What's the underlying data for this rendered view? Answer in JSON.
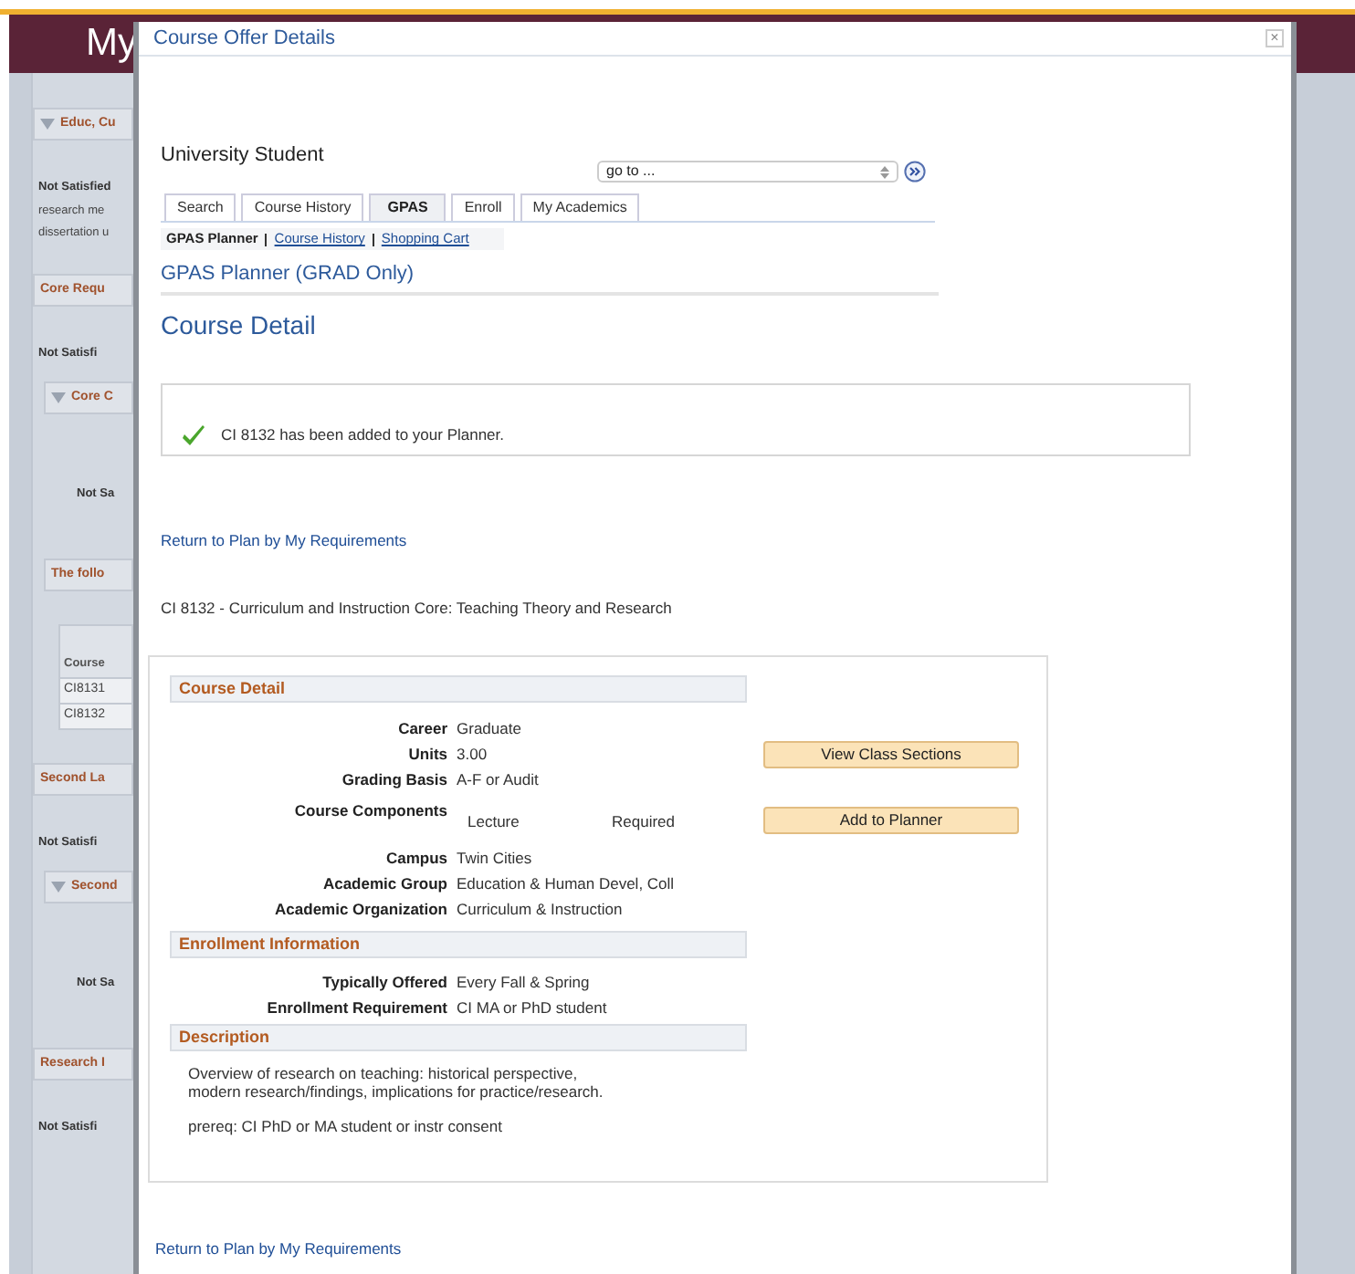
{
  "background": {
    "header_title": "My",
    "items": [
      {
        "kind": "section",
        "text": "Educ, Cu",
        "collapsible": true
      },
      {
        "kind": "status",
        "text": "Not Satisfied"
      },
      {
        "kind": "note",
        "text": "research me"
      },
      {
        "kind": "note",
        "text": "dissertation u"
      },
      {
        "kind": "section",
        "text": "Core Requ",
        "collapsible": false
      },
      {
        "kind": "status",
        "text": "Not Satisfi"
      },
      {
        "kind": "subsection",
        "text": "Core C",
        "collapsible": true
      },
      {
        "kind": "substatus",
        "text": "Not Sa"
      },
      {
        "kind": "subsection",
        "text": "The follo",
        "collapsible": false
      },
      {
        "kind": "table",
        "header": "Course",
        "rows": [
          "CI8131",
          "CI8132"
        ]
      },
      {
        "kind": "section",
        "text": "Second La",
        "collapsible": false
      },
      {
        "kind": "status",
        "text": "Not Satisfi"
      },
      {
        "kind": "subsection",
        "text": "Second",
        "collapsible": true
      },
      {
        "kind": "substatus",
        "text": "Not Sa"
      },
      {
        "kind": "section",
        "text": "Research I",
        "collapsible": false
      },
      {
        "kind": "status",
        "text": "Not Satisfi"
      }
    ]
  },
  "modal": {
    "title": "Course Offer Details",
    "close": "×",
    "student": "University Student",
    "goto": {
      "value": "go to ..."
    },
    "tabs": [
      {
        "label": "Search",
        "selected": false
      },
      {
        "label": "Course History",
        "selected": false
      },
      {
        "label": "GPAS",
        "selected": true
      },
      {
        "label": "Enroll",
        "selected": false
      },
      {
        "label": "My Academics",
        "selected": false
      }
    ],
    "sublinks": [
      {
        "label": "GPAS Planner",
        "selected": true
      },
      {
        "label": "Course History",
        "selected": false
      },
      {
        "label": "Shopping Cart",
        "selected": false
      }
    ],
    "page_title": "GPAS Planner (GRAD Only)",
    "heading": "Course Detail",
    "message": "CI 8132 has been added to your Planner.",
    "return_link": "Return to Plan by My Requirements",
    "course_title": "CI 8132 - Curriculum and Instruction Core: Teaching Theory and Research",
    "sections": [
      {
        "title": "Course Detail",
        "fields": [
          {
            "kind": "pair",
            "label": "Career",
            "value": "Graduate"
          },
          {
            "kind": "pair",
            "label": "Units",
            "value": "3.00"
          },
          {
            "kind": "pair",
            "label": "Grading Basis",
            "value": "A-F or Audit"
          },
          {
            "kind": "components",
            "label": "Course Components",
            "values": [
              "Lecture",
              "Required"
            ]
          },
          {
            "kind": "pair",
            "label": "Campus",
            "value": "Twin Cities"
          },
          {
            "kind": "pair",
            "label": "Academic Group",
            "value": "Education & Human Devel, Coll"
          },
          {
            "kind": "pair",
            "label": "Academic Organization",
            "value": "Curriculum & Instruction"
          }
        ]
      },
      {
        "title": "Enrollment Information",
        "fields": [
          {
            "kind": "pair",
            "label": "Typically Offered",
            "value": "Every Fall & Spring"
          },
          {
            "kind": "pair",
            "label": "Enrollment Requirement",
            "value": "CI MA or PhD student"
          }
        ]
      },
      {
        "title": "Description",
        "paragraphs": [
          "Overview of research on teaching: historical perspective, modern research/findings, implications for practice/research.",
          "prereq: CI PhD or MA student or instr consent"
        ]
      }
    ],
    "buttons": [
      "View Class Sections",
      "Add to Planner"
    ],
    "bottom_link": "Return to Plan by My Requirements"
  }
}
